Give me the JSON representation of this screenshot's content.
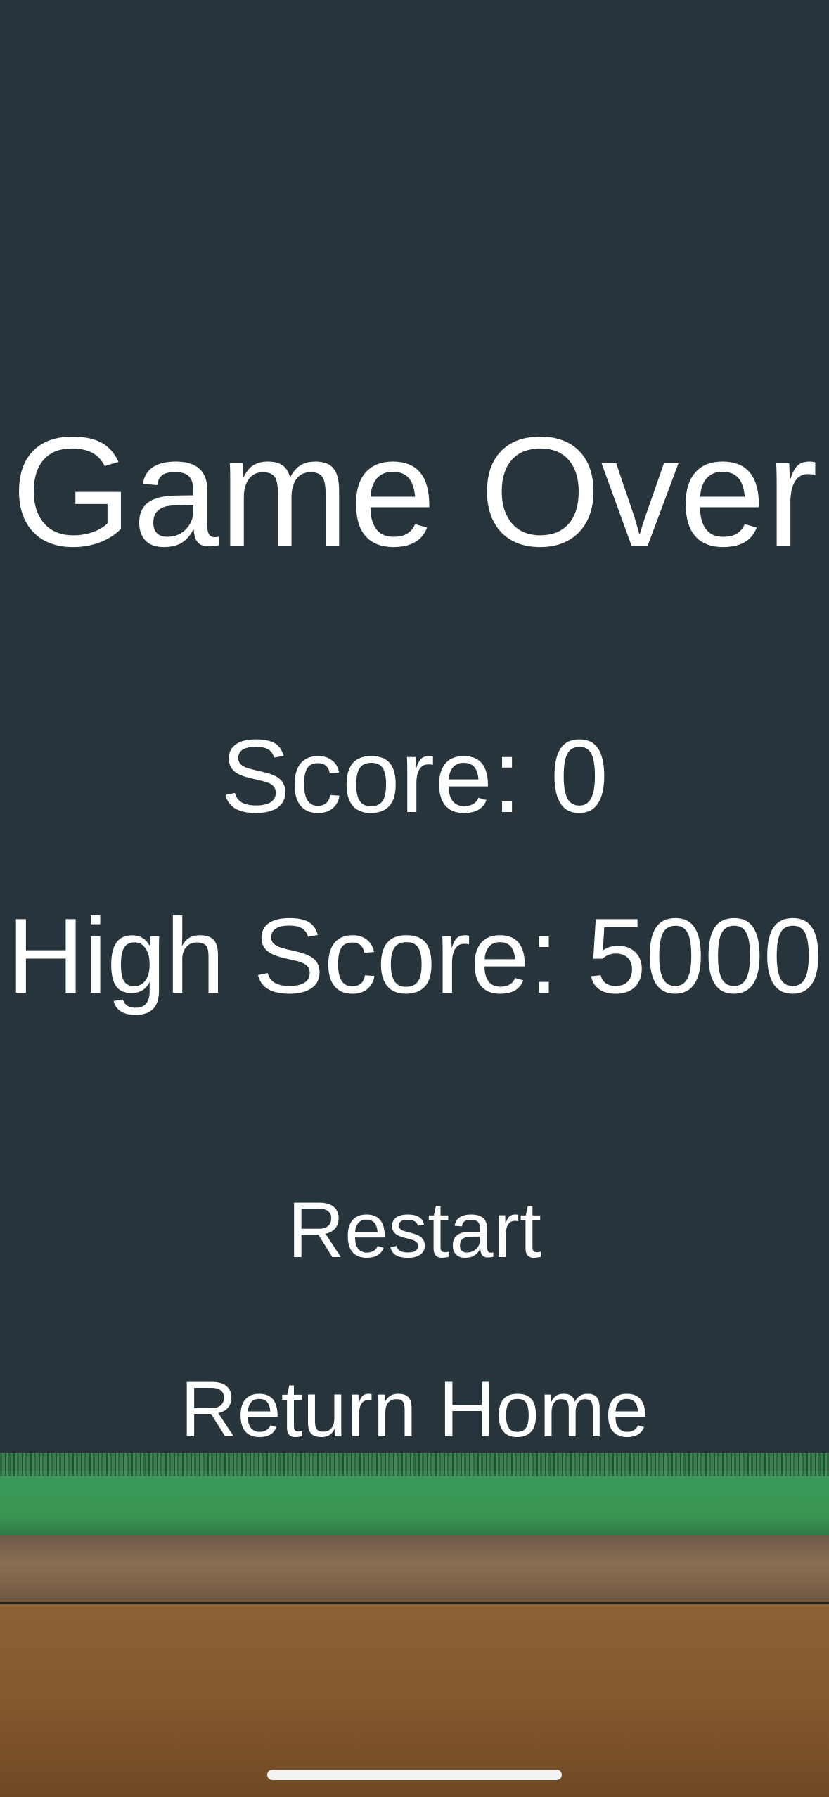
{
  "game_over": {
    "title": "Game Over",
    "score_text": "Score: 0",
    "high_score_text": "High Score: 5000",
    "score": 0,
    "high_score": 5000
  },
  "menu": {
    "restart_label": "Restart",
    "return_home_label": "Return Home"
  },
  "colors": {
    "background": "#27343c",
    "text": "#ffffff",
    "grass": "#3b9a5c",
    "dirt_top": "#8a6e54",
    "dirt_bottom": "#84592d",
    "home_indicator": "#f2f2f2"
  }
}
